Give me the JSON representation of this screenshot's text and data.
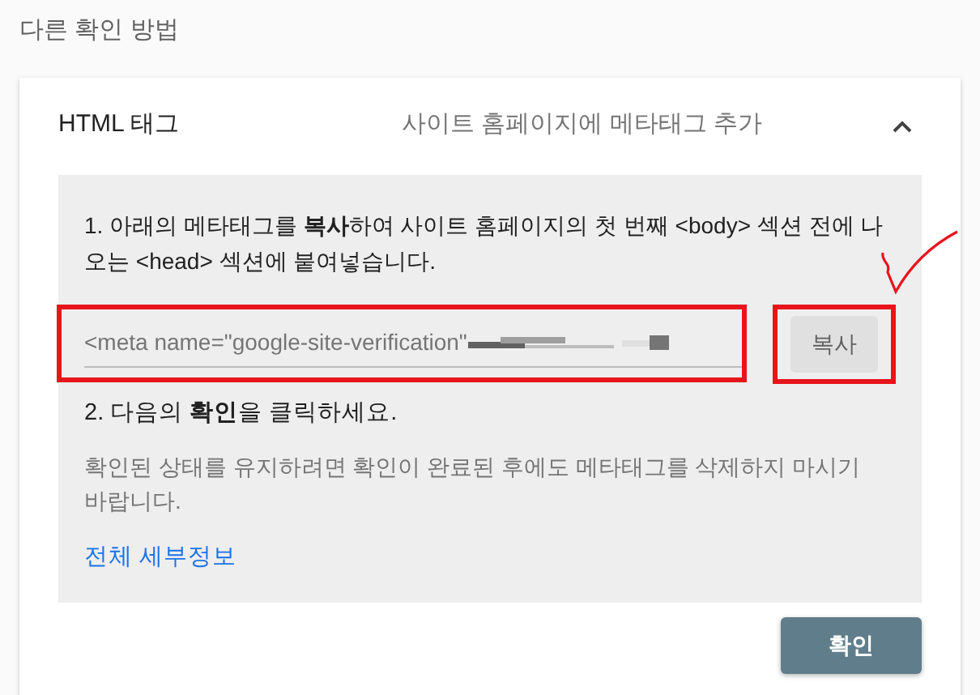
{
  "heading": "다른 확인 방법",
  "method": {
    "title": "HTML 태그",
    "description": "사이트 홈페이지에 메타태그 추가",
    "expanded": true
  },
  "step_1": "1. 아래의 메타태그를 **복사**하여 사이트 홈페이지의 첫 번째 <body> 섹션 전에 나오는 <head> 섹션에 붙여넣습니다.",
  "meta_tag_field": {
    "value": "<meta name=\"google-site-verification\"",
    "highlighted": true
  },
  "copy_button": {
    "label": "복사",
    "highlighted": true
  },
  "step_2": "2. 다음의 **확인**을 클릭하세요.",
  "note": "확인된 상태를 유지하려면 확인이 완료된 후에도 메타태그를 삭제하지 마시기 바랍니다.",
  "details_link": "전체 세부정보",
  "confirm_button": "확인"
}
